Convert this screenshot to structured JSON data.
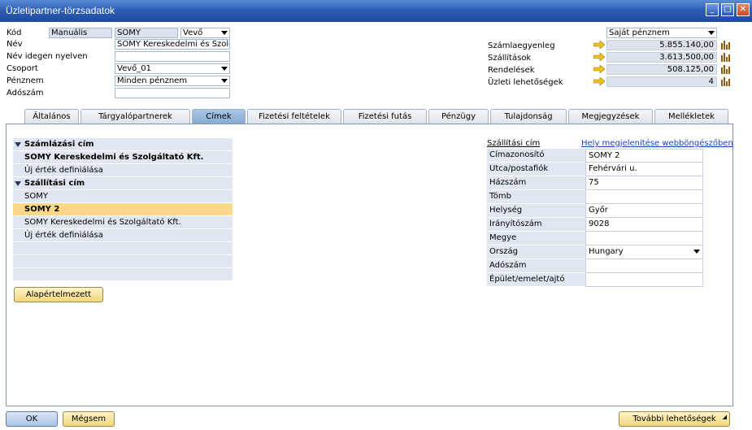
{
  "window": {
    "title": "Üzletipartner-törzsadatok"
  },
  "header": {
    "kod": {
      "label": "Kód",
      "series": "Manuális",
      "value": "SOMY",
      "type": "Vevő"
    },
    "nev": {
      "label": "Név",
      "value": "SOMY Kereskedelmi és Szolgálta"
    },
    "nev_idegen": {
      "label": "Név idegen nyelven",
      "value": ""
    },
    "csoport": {
      "label": "Csoport",
      "value": "Vevő_01"
    },
    "penznem": {
      "label": "Pénznem",
      "value": "Minden pénznem"
    },
    "adoszam": {
      "label": "Adószám",
      "value": ""
    }
  },
  "balances": {
    "currency": "Saját pénznem",
    "items": [
      {
        "label": "Számlaegyenleg",
        "value": "5.855.140,00"
      },
      {
        "label": "Szállítások",
        "value": "3.613.500,00"
      },
      {
        "label": "Rendelések",
        "value": "508.125,00"
      },
      {
        "label": "Üzleti lehetőségek",
        "value": "4"
      }
    ]
  },
  "tabs": [
    "Általános",
    "Tárgyalópartnerek",
    "Címek",
    "Fizetési feltételek",
    "Fizetési futás",
    "Pénzügy",
    "Tulajdonság",
    "Megjegyzések",
    "Mellékletek"
  ],
  "addresses": {
    "billing_header": "Számlázási cím",
    "billing_items": [
      "SOMY Kereskedelmi és Szolgáltató Kft.",
      "Új érték definiálása"
    ],
    "shipping_header": "Szállítási cím",
    "shipping_items": [
      "SOMY",
      "SOMY 2",
      "SOMY Kereskedelmi és Szolgáltató Kft.",
      "Új érték definiálása"
    ],
    "default_button": "Alapértelmezett"
  },
  "detail": {
    "title": "Szállítási cím",
    "browser_link": "Hely megjelenítése webböngészőben",
    "rows": [
      {
        "k": "Címazonosító",
        "v": "SOMY 2"
      },
      {
        "k": "Utca/postafiók",
        "v": "Fehérvári u."
      },
      {
        "k": "Házszám",
        "v": "75"
      },
      {
        "k": "Tömb",
        "v": ""
      },
      {
        "k": "Helység",
        "v": "Győr"
      },
      {
        "k": "Irányítószám",
        "v": "9028"
      },
      {
        "k": "Megye",
        "v": ""
      },
      {
        "k": "Ország",
        "v": "Hungary"
      },
      {
        "k": "Adószám",
        "v": ""
      },
      {
        "k": "Épület/emelet/ajtó",
        "v": ""
      }
    ]
  },
  "footer": {
    "ok": "OK",
    "cancel": "Mégsem",
    "more": "További lehetőségek"
  }
}
